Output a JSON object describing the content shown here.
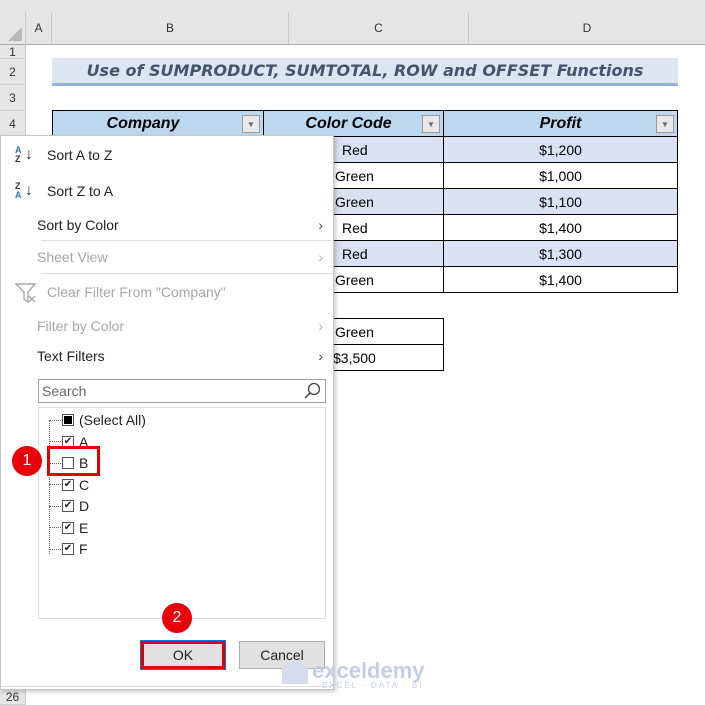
{
  "sheet": {
    "columns": [
      "A",
      "B",
      "C",
      "D"
    ],
    "rows": [
      "1",
      "2",
      "3",
      "4",
      "26"
    ],
    "title": "Use of SUMPRODUCT, SUMTOTAL, ROW and OFFSET Functions",
    "table": {
      "headers": [
        "Company",
        "Color Code",
        "Profit"
      ],
      "rows": [
        {
          "color": "Red",
          "profit": "$1,200"
        },
        {
          "color": "Green",
          "profit": "$1,000"
        },
        {
          "color": "Green",
          "profit": "$1,100"
        },
        {
          "color": "Red",
          "profit": "$1,400"
        },
        {
          "color": "Red",
          "profit": "$1,300"
        },
        {
          "color": "Green",
          "profit": "$1,400"
        }
      ]
    },
    "criteria": {
      "color": "Green",
      "result": "$3,500"
    }
  },
  "filter_menu": {
    "sort_az": "Sort A to Z",
    "sort_za": "Sort Z to A",
    "sort_by_color": "Sort by Color",
    "sheet_view": "Sheet View",
    "clear_filter": "Clear Filter From \"Company\"",
    "filter_by_color": "Filter by Color",
    "text_filters": "Text Filters",
    "search_placeholder": "Search",
    "items": [
      {
        "label": "(Select All)",
        "state": "partial"
      },
      {
        "label": "A",
        "state": "checked"
      },
      {
        "label": "B",
        "state": "unchecked"
      },
      {
        "label": "C",
        "state": "checked"
      },
      {
        "label": "D",
        "state": "checked"
      },
      {
        "label": "E",
        "state": "checked"
      },
      {
        "label": "F",
        "state": "checked"
      }
    ],
    "ok": "OK",
    "cancel": "Cancel"
  },
  "annotations": {
    "step1": "1",
    "step2": "2"
  },
  "watermark": {
    "name": "exceldemy",
    "tagline": "EXCEL · DATA · BI"
  }
}
